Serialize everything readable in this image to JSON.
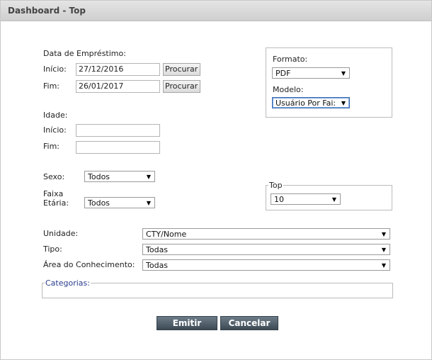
{
  "title": "Dashboard - Top",
  "emprestimo": {
    "section_label": "Data de Empréstimo:",
    "inicio_label": "Início:",
    "inicio_value": "27/12/2016",
    "fim_label": "Fim:",
    "fim_value": "26/01/2017",
    "search_label": "Procurar"
  },
  "idade": {
    "section_label": "Idade:",
    "inicio_label": "Início:",
    "inicio_value": "",
    "fim_label": "Fim:",
    "fim_value": ""
  },
  "sexo": {
    "label": "Sexo:",
    "value": "Todos"
  },
  "faixa": {
    "label_line1": "Faixa",
    "label_line2": "Etária:",
    "value": "Todos"
  },
  "formato": {
    "label": "Formato:",
    "value": "PDF"
  },
  "modelo": {
    "label": "Modelo:",
    "value": "Usuário Por Fai:"
  },
  "top": {
    "legend": "Top",
    "value": "10"
  },
  "unidade": {
    "label": "Unidade:",
    "value": "CTY/Nome"
  },
  "tipo": {
    "label": "Tipo:",
    "value": "Todas"
  },
  "area": {
    "label": "Área do Conhecimento:",
    "value": "Todas"
  },
  "categorias": {
    "legend": "Categorias:"
  },
  "buttons": {
    "emitir": "Emitir",
    "cancelar": "Cancelar"
  },
  "icons": {
    "dropdown": "chevron-down-icon"
  },
  "colors": {
    "button_bg": "#4b5864",
    "titlebar": "#d8d8d8",
    "legend_text": "#2a3c8e"
  }
}
